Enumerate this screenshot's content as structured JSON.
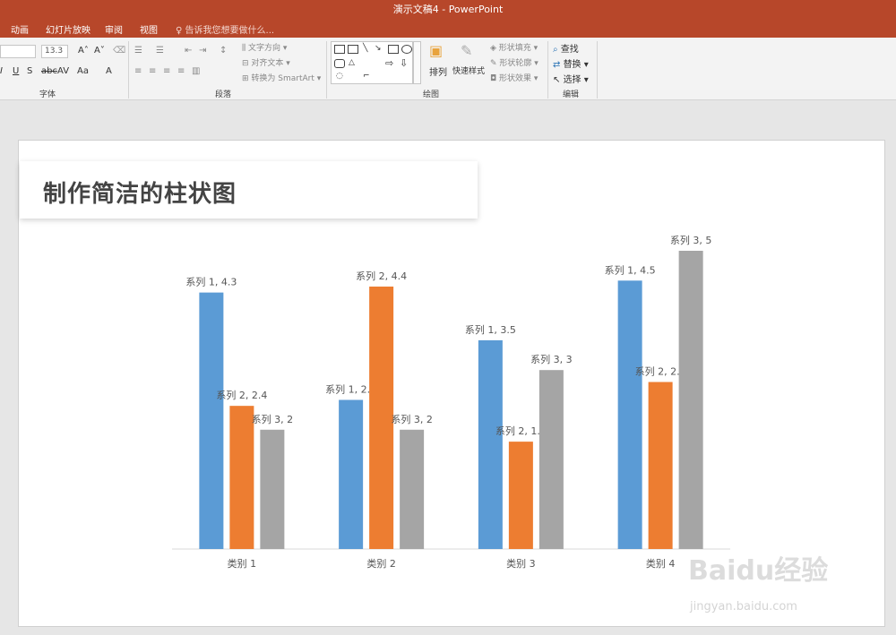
{
  "app": {
    "window_title": "演示文稿4 - PowerPoint",
    "tabs": [
      "动画",
      "幻灯片放映",
      "审阅",
      "视图"
    ],
    "tell_me": "告诉我您想要做什么..."
  },
  "ribbon": {
    "font_size": "13.3",
    "groups": {
      "font": "字体",
      "paragraph": "段落",
      "drawing": "绘图",
      "editing": "编辑"
    },
    "paragraph_buttons": {
      "text_direction": "文字方向",
      "align_text": "对齐文本",
      "convert_smartart": "转换为 SmartArt"
    },
    "drawing_buttons": {
      "arrange": "排列",
      "quick_styles": "快速样式",
      "shape_fill": "形状填充",
      "shape_outline": "形状轮廓",
      "shape_effects": "形状效果"
    },
    "editing_buttons": {
      "find": "查找",
      "replace": "替换",
      "select": "选择"
    }
  },
  "slide": {
    "title": "制作简洁的柱状图"
  },
  "chart_data": {
    "type": "bar",
    "categories": [
      "类别 1",
      "类别 2",
      "类别 3",
      "类别 4"
    ],
    "series": [
      {
        "name": "系列 1",
        "values": [
          4.3,
          2.5,
          3.5,
          4.5
        ],
        "color": "#5b9bd5",
        "labels": [
          "系列 1, 4.3",
          "系列 1, 2.5",
          "系列 1, 3.5",
          "系列 1, 4.5"
        ]
      },
      {
        "name": "系列 2",
        "values": [
          2.4,
          4.4,
          1.8,
          2.8
        ],
        "color": "#ed7d31",
        "labels": [
          "系列 2, 2.4",
          "系列 2, 4.4",
          "系列 2, 1.8",
          "系列 2, 2.8"
        ]
      },
      {
        "name": "系列 3",
        "values": [
          2,
          2,
          3,
          5
        ],
        "color": "#a5a5a5",
        "labels": [
          "系列 3, 2",
          "系列 3, 2",
          "系列 3, 3",
          "系列 3, 5"
        ]
      }
    ],
    "ylim": [
      0,
      5
    ],
    "grid": false,
    "legend": "none"
  },
  "watermark": {
    "brand": "Baidu经验",
    "url": "jingyan.baidu.com"
  }
}
